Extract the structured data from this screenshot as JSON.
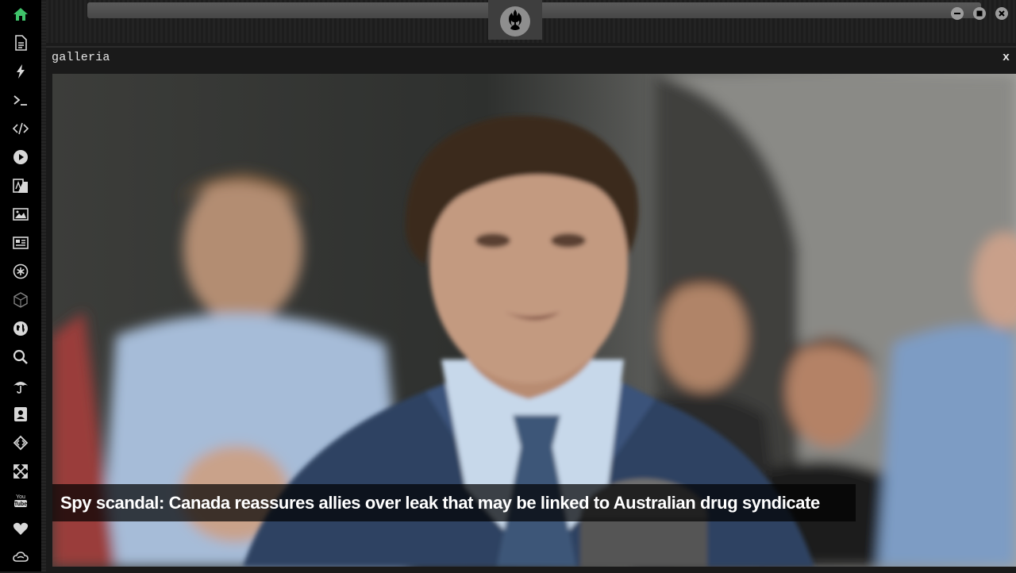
{
  "window": {
    "title": "galleria",
    "close_label": "x"
  },
  "caption": "Spy scandal: Canada reassures allies over leak that may be linked to Australian drug syndicate",
  "photo": {
    "alt": "Man in blue suit speaking at a podium outdoors, with people standing behind him"
  },
  "sidebar": {
    "items": [
      {
        "icon": "home-icon",
        "active": true
      },
      {
        "icon": "document-icon"
      },
      {
        "icon": "lightning-icon"
      },
      {
        "icon": "terminal-icon"
      },
      {
        "icon": "code-icon"
      },
      {
        "icon": "play-icon"
      },
      {
        "icon": "translate-icon"
      },
      {
        "icon": "image-icon"
      },
      {
        "icon": "newspaper-icon"
      },
      {
        "icon": "asterisk-icon"
      },
      {
        "icon": "cube-icon"
      },
      {
        "icon": "globe-icon"
      },
      {
        "icon": "search-icon"
      },
      {
        "icon": "umbrella-icon"
      },
      {
        "icon": "contact-card-icon"
      },
      {
        "icon": "diamond-code-icon"
      },
      {
        "icon": "expand-icon"
      },
      {
        "icon": "youtube-icon"
      },
      {
        "icon": "heart-icon"
      },
      {
        "icon": "cloud-icon"
      }
    ]
  },
  "colors": {
    "active_icon": "#3fc36a",
    "icon": "#d8d8d8",
    "background": "#1b1b1b"
  }
}
